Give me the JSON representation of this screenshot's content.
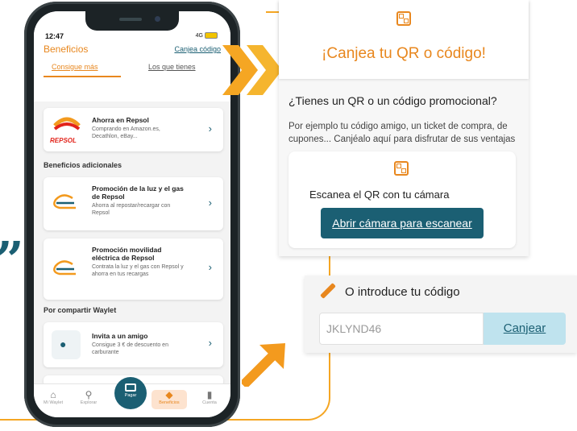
{
  "phone": {
    "time": "12:47",
    "network": "4G",
    "header_title": "Beneficios",
    "header_link": "Canjea código",
    "tabs": [
      "Consigue más",
      "Los que tienes"
    ],
    "repsol_card": {
      "logo_text": "REPSOL",
      "title": "Ahorra en Repsol",
      "subtitle": "Comprando en Amazon.es, Decathlon, eBay..."
    },
    "section_additional": "Beneficios adicionales",
    "card_luz": {
      "title": "Promoción de la luz y el gas de Repsol",
      "subtitle": "Ahorra al repostar/recargar con Repsol"
    },
    "card_movilidad": {
      "title": "Promoción movilidad eléctrica de Repsol",
      "subtitle": "Contrata la luz y el gas con Repsol y ahorra en tus recargas"
    },
    "section_share": "Por compartir Waylet",
    "card_invita": {
      "title": "Invita a un amigo",
      "subtitle": "Consigue 3 € de descuento en carburante"
    },
    "tabbar": {
      "mi_waylet": "Mi Waylet",
      "explorar": "Explorar",
      "pagar": "Pagar",
      "beneficios": "Beneficios",
      "cuenta": "Cuenta"
    }
  },
  "redeem": {
    "title": "¡Canjea tu QR o código!",
    "question": "¿Tienes un QR o un código promocional?",
    "description": "Por ejemplo tu código amigo, un ticket de compra, de cupones... Canjéalo aquí para disfrutar de sus ventajas",
    "scan_text": "Escanea el QR con tu cámara",
    "scan_button": "Abrir cámara para escanear"
  },
  "code": {
    "title": "O introduce tu código",
    "input_value": "JKLYND46",
    "button": "Canjear"
  },
  "colors": {
    "accent": "#e8871e",
    "primary": "#1b5f73",
    "chevron": "#f5a623"
  }
}
